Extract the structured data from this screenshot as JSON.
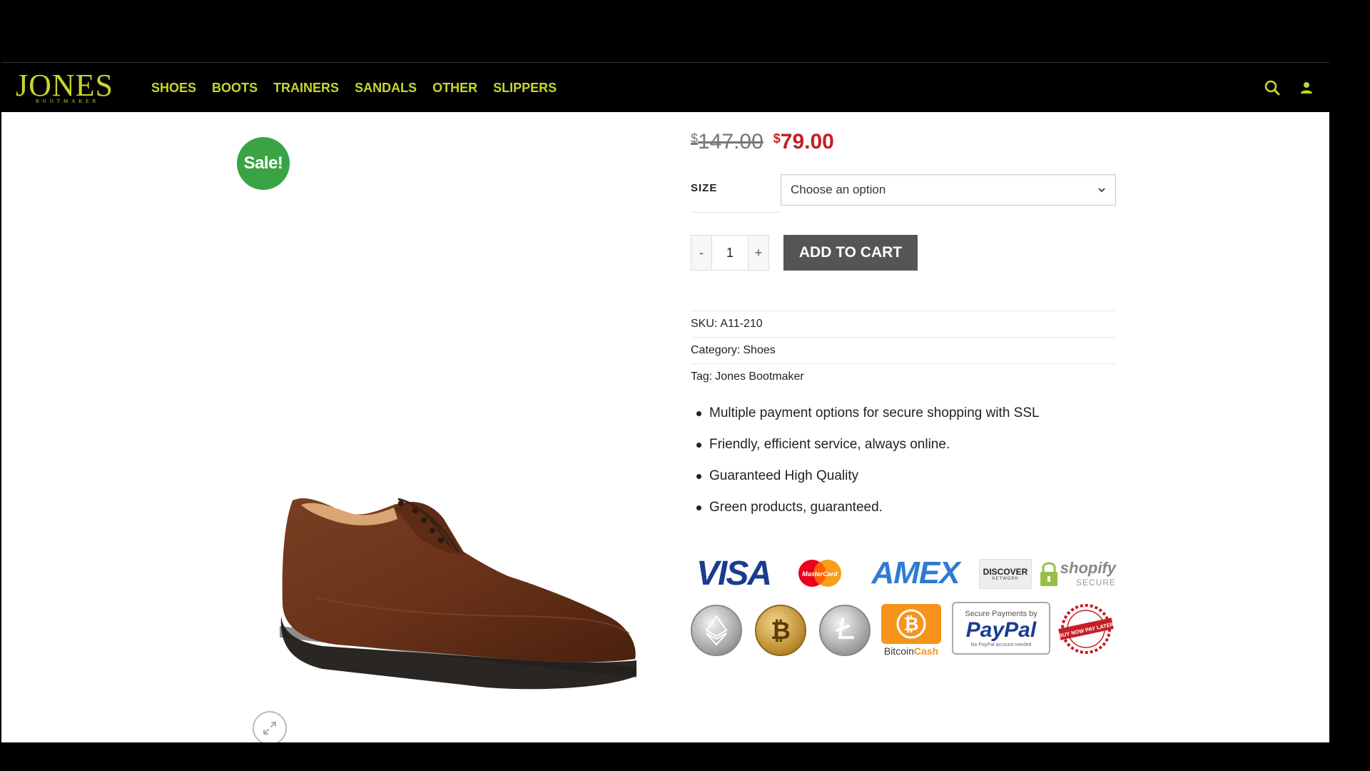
{
  "brand": {
    "name": "JONES",
    "tagline": "BOOTMAKER",
    "accent_color": "#c5d62b"
  },
  "nav": {
    "items": [
      {
        "label": "SHOES"
      },
      {
        "label": "BOOTS"
      },
      {
        "label": "TRAINERS"
      },
      {
        "label": "SANDALS"
      },
      {
        "label": "OTHER"
      },
      {
        "label": "SLIPPERS"
      }
    ]
  },
  "header_icons": [
    "search-icon",
    "user-icon"
  ],
  "product": {
    "badge": "Sale!",
    "old_price_currency": "$",
    "old_price": "147.00",
    "new_price_currency": "$",
    "new_price": "79.00",
    "sale_color": "#c41e24",
    "size_label": "SIZE",
    "size_placeholder": "Choose an option",
    "qty_minus": "-",
    "qty_value": "1",
    "qty_plus": "+",
    "add_to_cart": "ADD TO CART",
    "meta": {
      "sku_key": "SKU:",
      "sku_value": "A11-210",
      "category_key": "Category:",
      "category_value": "Shoes",
      "tag_key": "Tag:",
      "tag_value": "Jones Bootmaker"
    },
    "features": [
      "Multiple payment options for secure shopping with SSL",
      "Friendly, efficient service, always online.",
      "Guaranteed High Quality",
      "Green products, guaranteed."
    ]
  },
  "payments": {
    "visa": "VISA",
    "mastercard": "MasterCard",
    "amex": "AMEX",
    "discover": "DISCOVER",
    "discover_sub": "NETWORK",
    "shopify": "shopify",
    "shopify_sub": "SECURE",
    "bitcoincash_a": "Bitcoin",
    "bitcoincash_b": "Cash",
    "paypal_top": "Secure Payments by",
    "paypal": "PayPal",
    "paypal_bottom": "No PayPal account needed",
    "bnpl": "BUY NOW PAY LATER"
  }
}
